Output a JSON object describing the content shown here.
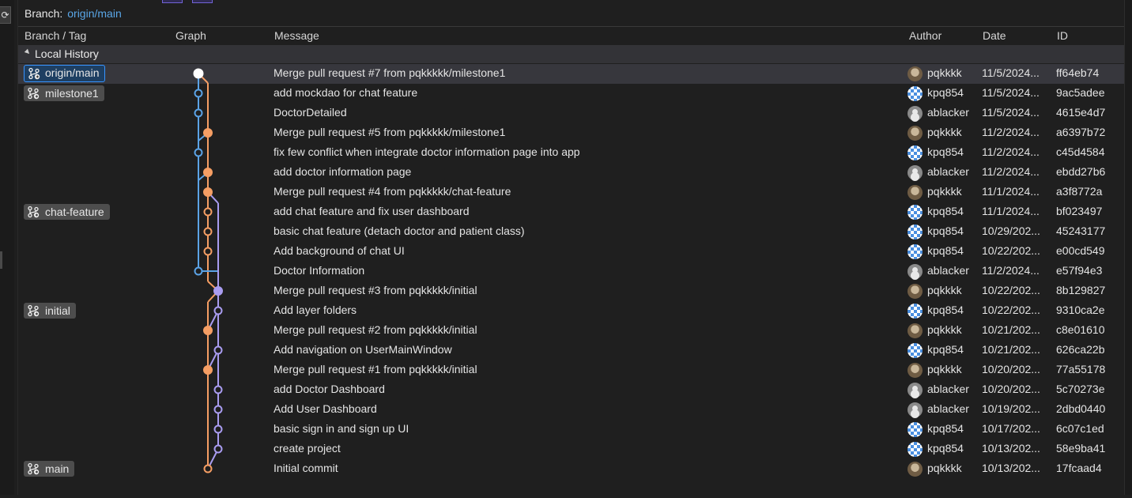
{
  "branch_bar": {
    "label": "Branch:",
    "value": "origin/main"
  },
  "columns": {
    "branch_tag": "Branch / Tag",
    "graph": "Graph",
    "message": "Message",
    "author": "Author",
    "date": "Date",
    "id": "ID"
  },
  "group": {
    "label": "Local History"
  },
  "colors": {
    "blue": "#5ba3e6",
    "orange": "#f59e64",
    "purple": "#a99cf0",
    "selected_bg": "#37373d",
    "accent": "#3794ff"
  },
  "commits": [
    {
      "message": "Merge pull request #7 from pqkkkkk/milestone1",
      "author": "pqkkkk",
      "avatar": "photo-avatar",
      "date": "11/5/2024...",
      "id": "ff64eb74",
      "tag": "origin/main",
      "selected": true
    },
    {
      "message": "add mockdao for chat feature",
      "author": "kpq854",
      "avatar": "identicon-avatar",
      "date": "11/5/2024...",
      "id": "9ac5adee",
      "tag": "milestone1"
    },
    {
      "message": "DoctorDetailed",
      "author": "ablacker",
      "avatar": "default-avatar",
      "date": "11/5/2024...",
      "id": "4615e4d7"
    },
    {
      "message": "Merge pull request #5 from pqkkkkk/milestone1",
      "author": "pqkkkk",
      "avatar": "photo-avatar",
      "date": "11/2/2024...",
      "id": "a6397b72"
    },
    {
      "message": "fix few conflict when integrate doctor information page into app",
      "author": "kpq854",
      "avatar": "identicon-avatar",
      "date": "11/2/2024...",
      "id": "c45d4584"
    },
    {
      "message": "add doctor information page",
      "author": "ablacker",
      "avatar": "default-avatar",
      "date": "11/2/2024...",
      "id": "ebdd27b6"
    },
    {
      "message": "Merge pull request #4 from pqkkkkk/chat-feature",
      "author": "pqkkkk",
      "avatar": "photo-avatar",
      "date": "11/1/2024...",
      "id": "a3f8772a"
    },
    {
      "message": "add chat feature and fix user dashboard",
      "author": "kpq854",
      "avatar": "identicon-avatar",
      "date": "11/1/2024...",
      "id": "bf023497",
      "tag": "chat-feature"
    },
    {
      "message": "basic chat feature (detach doctor and patient class)",
      "author": "kpq854",
      "avatar": "identicon-avatar",
      "date": "10/29/202...",
      "id": "45243177"
    },
    {
      "message": "Add background of chat UI",
      "author": "kpq854",
      "avatar": "identicon-avatar",
      "date": "10/22/202...",
      "id": "e00cd549"
    },
    {
      "message": "Doctor Information",
      "author": "ablacker",
      "avatar": "default-avatar",
      "date": "11/2/2024...",
      "id": "e57f94e3"
    },
    {
      "message": "Merge pull request #3 from pqkkkkk/initial",
      "author": "pqkkkk",
      "avatar": "photo-avatar",
      "date": "10/22/202...",
      "id": "8b129827"
    },
    {
      "message": "Add layer folders",
      "author": "kpq854",
      "avatar": "identicon-avatar",
      "date": "10/22/202...",
      "id": "9310ca2e",
      "tag": "initial"
    },
    {
      "message": "Merge pull request #2 from pqkkkkk/initial",
      "author": "pqkkkk",
      "avatar": "photo-avatar",
      "date": "10/21/202...",
      "id": "c8e01610"
    },
    {
      "message": "Add navigation on UserMainWindow",
      "author": "kpq854",
      "avatar": "identicon-avatar",
      "date": "10/21/202...",
      "id": "626ca22b"
    },
    {
      "message": "Merge pull request #1 from pqkkkkk/initial",
      "author": "pqkkkk",
      "avatar": "photo-avatar",
      "date": "10/20/202...",
      "id": "77a55178"
    },
    {
      "message": "add Doctor Dashboard",
      "author": "ablacker",
      "avatar": "default-avatar",
      "date": "10/20/202...",
      "id": "5c70273e"
    },
    {
      "message": "Add User Dashboard",
      "author": "ablacker",
      "avatar": "default-avatar",
      "date": "10/19/202...",
      "id": "2dbd0440"
    },
    {
      "message": "basic sign in and sign up UI",
      "author": "kpq854",
      "avatar": "identicon-avatar",
      "date": "10/17/202...",
      "id": "6c07c1ed"
    },
    {
      "message": "create project",
      "author": "kpq854",
      "avatar": "identicon-avatar",
      "date": "10/13/202...",
      "id": "58e9ba41"
    },
    {
      "message": "Initial commit",
      "author": "pqkkkk",
      "avatar": "photo-avatar",
      "date": "10/13/202...",
      "id": "17fcaad4",
      "tag": "main"
    }
  ]
}
